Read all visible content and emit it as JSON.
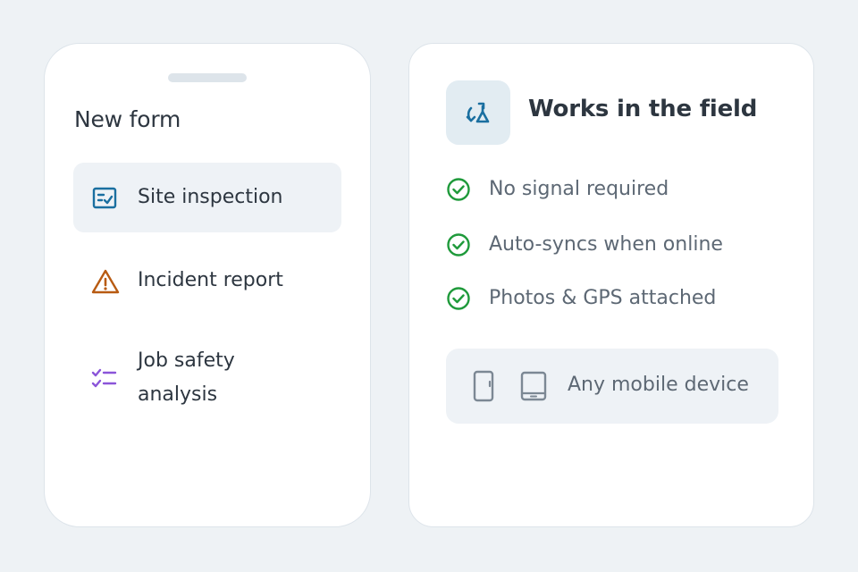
{
  "form_card": {
    "title": "New form",
    "items": [
      {
        "label": "Site inspection",
        "icon": "clipboard-check-icon",
        "selected": true
      },
      {
        "label": "Incident report",
        "icon": "warning-triangle-icon",
        "selected": false
      },
      {
        "label_line1": "Job safety",
        "label_line2": "analysis",
        "icon": "checklist-icon",
        "selected": false
      }
    ]
  },
  "field_card": {
    "title": "Works in the field",
    "icon": "sync-icon",
    "features": [
      {
        "label": "No signal required",
        "icon": "check-circle-icon"
      },
      {
        "label": "Auto-syncs when online",
        "icon": "check-circle-icon"
      },
      {
        "label": "Photos & GPS attached",
        "icon": "check-circle-icon"
      }
    ],
    "devices": {
      "label": "Any mobile device",
      "icons": [
        "phone-icon",
        "tablet-icon"
      ]
    }
  },
  "colors": {
    "background": "#eef2f5",
    "card": "#ffffff",
    "text_primary": "#2d3640",
    "text_secondary": "#5d6874",
    "blue": "#1a6fa0",
    "orange": "#b85b12",
    "purple": "#8b55d9",
    "green": "#1f9a3b",
    "gray_icon": "#7c8894"
  }
}
